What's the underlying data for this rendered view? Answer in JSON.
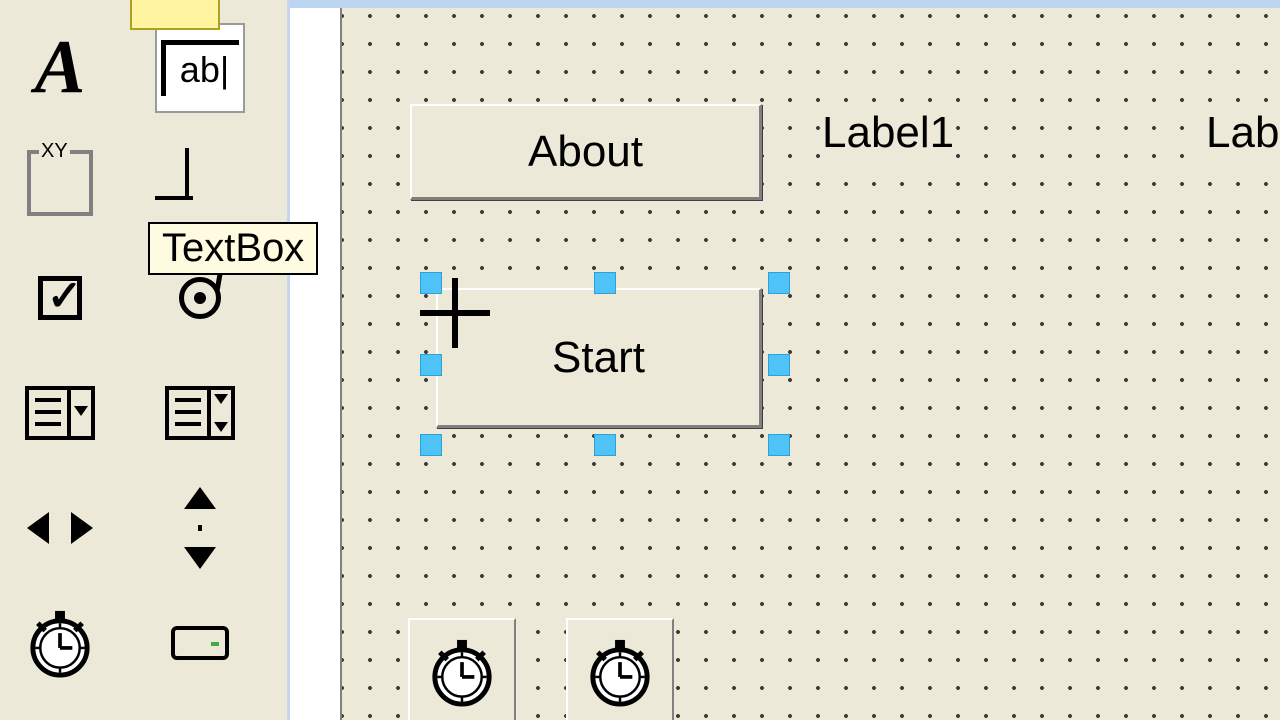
{
  "toolbox": {
    "tooltip_textbox": "TextBox",
    "tools": {
      "label": "Label",
      "textbox": "TextBox",
      "frame": "Frame",
      "commandbutton": "CommandButton",
      "checkbox": "CheckBox",
      "optionbutton": "OptionButton",
      "combobox": "ComboBox",
      "listbox": "ListBox",
      "hscrollbar": "HScrollBar",
      "vscrollbar": "VScrollBar",
      "timer": "Timer",
      "drivelistbox": "DriveListBox"
    },
    "textbox_glyph": "ab|",
    "frame_glyph": "XY"
  },
  "form": {
    "button_about": "About",
    "button_start": "Start",
    "label1": "Label1",
    "label2": "Lab",
    "timer1": "Timer1",
    "timer2": "Timer2"
  }
}
